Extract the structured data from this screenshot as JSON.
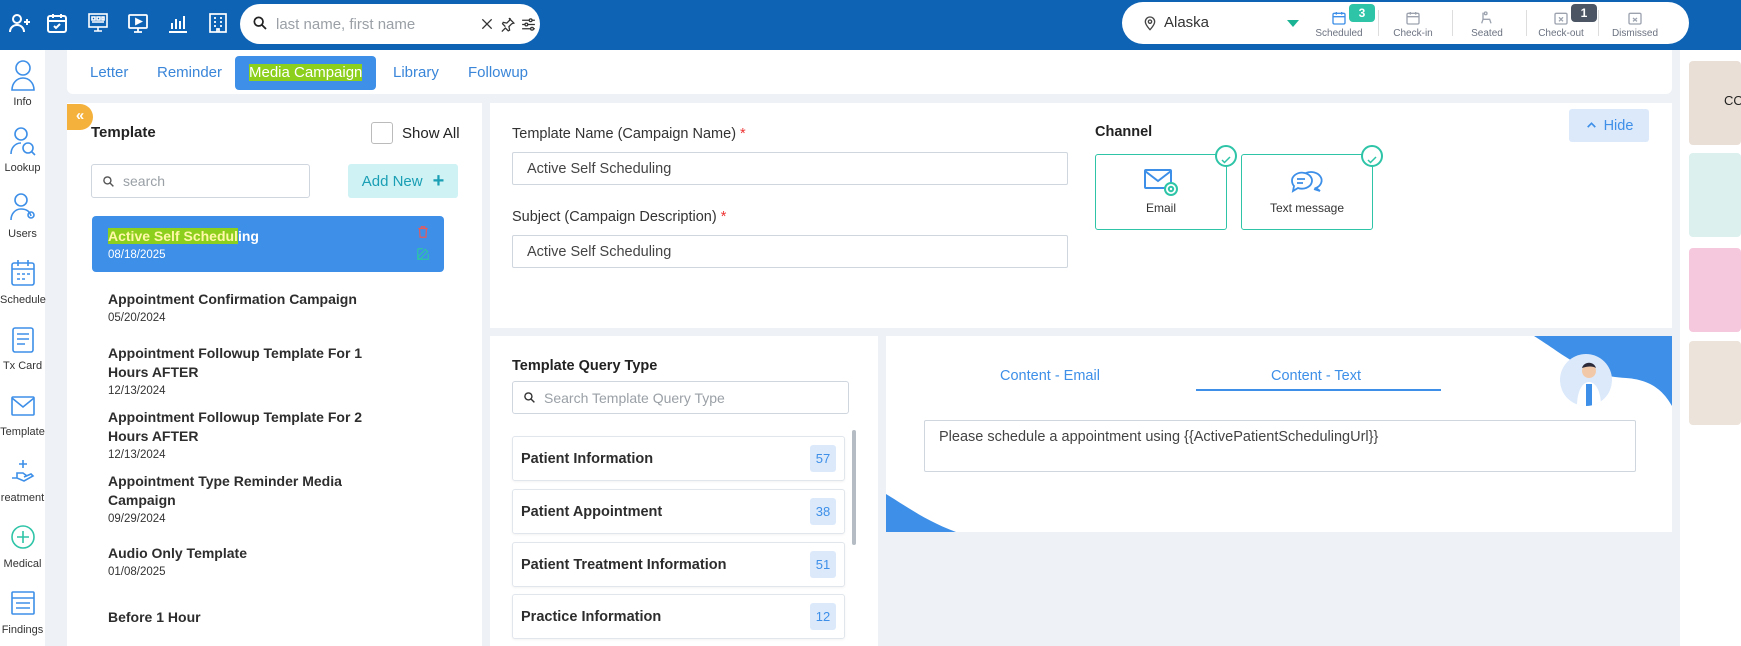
{
  "topbar": {
    "search_placeholder": "last name, first name",
    "location": "Alaska",
    "statuses": [
      {
        "label": "Scheduled",
        "badge": "3"
      },
      {
        "label": "Check-in",
        "badge": ""
      },
      {
        "label": "Seated",
        "badge": ""
      },
      {
        "label": "Check-out",
        "badge": "1"
      },
      {
        "label": "Dismissed",
        "badge": ""
      }
    ],
    "colors": {
      "bar": "#0f63b5",
      "scheduled_badge": "#2ec4a7",
      "checkout_badge": "#4b5563"
    }
  },
  "sidebar": {
    "items": [
      {
        "label": "Info",
        "icon": "user-icon"
      },
      {
        "label": "Lookup",
        "icon": "user-search-icon"
      },
      {
        "label": "Users",
        "icon": "users-icon"
      },
      {
        "label": "Schedule",
        "icon": "calendar-icon"
      },
      {
        "label": "Tx Card",
        "icon": "card-icon"
      },
      {
        "label": "Template",
        "icon": "envelope-icon"
      },
      {
        "label": "reatment",
        "icon": "hand-icon"
      },
      {
        "label": "Medical",
        "icon": "medical-cross-icon"
      },
      {
        "label": "Findings",
        "icon": "findings-icon"
      }
    ]
  },
  "tabs": {
    "items": [
      "Letter",
      "Reminder",
      "Media Campaign",
      "Library",
      "Followup"
    ],
    "active": "Media Campaign"
  },
  "templates": {
    "title": "Template",
    "show_all_label": "Show All",
    "search_placeholder": "search",
    "add_new_label": "Add New",
    "items": [
      {
        "name_hl": "Active Self Schedul",
        "name_rest": "ing",
        "date": "08/18/2025"
      },
      {
        "name": "Appointment Confirmation Campaign",
        "date": "05/20/2024"
      },
      {
        "name_l1": "Appointment Followup Template For 1",
        "name_l2": "Hours AFTER",
        "date": "12/13/2024"
      },
      {
        "name_l1": "Appointment Followup Template For 2",
        "name_l2": "Hours AFTER",
        "date": "12/13/2024"
      },
      {
        "name_l1": "Appointment Type Reminder Media",
        "name_l2": "Campaign",
        "date": "09/29/2024"
      },
      {
        "name": "Audio Only Template",
        "date": "01/08/2025"
      },
      {
        "name": "Before 1 Hour",
        "date": ""
      }
    ]
  },
  "form": {
    "template_name_label": "Template Name (Campaign Name)",
    "template_name_value": "Active Self Scheduling",
    "subject_label": "Subject (Campaign Description)",
    "subject_value": "Active Self Scheduling",
    "required_mark": "*",
    "channel_title": "Channel",
    "channels": [
      {
        "label": "Email",
        "selected": true
      },
      {
        "label": "Text message",
        "selected": true
      }
    ],
    "hide_label": "Hide"
  },
  "query": {
    "title": "Template Query Type",
    "search_placeholder": "Search Template Query Type",
    "items": [
      {
        "label": "Patient Information",
        "count": "57"
      },
      {
        "label": "Patient Appointment",
        "count": "38"
      },
      {
        "label": "Patient Treatment Information",
        "count": "51"
      },
      {
        "label": "Practice Information",
        "count": "12"
      }
    ]
  },
  "content": {
    "tabs": [
      "Content - Email",
      "Content - Text"
    ],
    "active_tab": "Content - Text",
    "text": "Please schedule a appointment using {{ActivePatientSchedulingUrl}}"
  },
  "right_rail": {
    "cards": [
      {
        "label": "CO",
        "color": "#eadfd6"
      },
      {
        "label": "",
        "color": "#dcf0ee"
      },
      {
        "label": "",
        "color": "#f6c8de"
      },
      {
        "label": "",
        "color": "#ece3da"
      }
    ]
  }
}
